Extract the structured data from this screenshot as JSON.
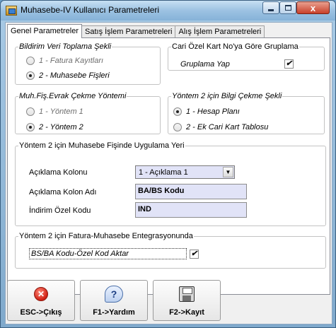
{
  "window": {
    "title": "Muhasebe-IV Kullanıcı Parametreleri"
  },
  "title_controls": {
    "minimize_icon": "minimize-icon",
    "maximize_icon": "maximize-icon",
    "close_glyph": "x"
  },
  "tabs": [
    {
      "label": "Genel Parametreler",
      "active": true
    },
    {
      "label": "Satış İşlem Parametreleri",
      "active": false
    },
    {
      "label": "Alış İşlem Parametreleri",
      "active": false
    }
  ],
  "groups": {
    "bildirim": {
      "legend": "Bildirim Veri Toplama Şekli",
      "options": [
        {
          "label": "1 - Fatura Kayıtları",
          "selected": false
        },
        {
          "label": "2 - Muhasebe Fişleri",
          "selected": true
        }
      ]
    },
    "cari": {
      "legend": "Cari Özel Kart No'ya Göre Gruplama",
      "checkbox_label": "Gruplama Yap",
      "checked": true
    },
    "muhfis": {
      "legend": "Muh.Fiş.Evrak Çekme Yöntemi",
      "options": [
        {
          "label": "1 - Yöntem 1",
          "selected": false
        },
        {
          "label": "2 - Yöntem 2",
          "selected": true
        }
      ]
    },
    "yontem2bilgi": {
      "legend": "Yöntem 2 için Bilgi Çekme Şekli",
      "options": [
        {
          "label": "1 - Hesap Planı",
          "selected": true
        },
        {
          "label": "2 - Ek Cari Kart Tablosu",
          "selected": false
        }
      ]
    },
    "yontem2muh": {
      "legend": "Yöntem 2 için Muhasebe Fişinde Uygulama Yeri",
      "aciklama_kolonu_label": "Açıklama Kolonu",
      "aciklama_kolonu_value": "1 - Açıklama 1",
      "aciklama_kolon_adi_label": "Açıklama Kolon Adı",
      "aciklama_kolon_adi_value": "BA/BS Kodu",
      "indirim_ozel_kodu_label": "İndirim Özel Kodu",
      "indirim_ozel_kodu_value": "IND"
    },
    "yontem2fatura": {
      "legend": "Yöntem 2 için Fatura-Muhasebe Entegrasyonunda",
      "checkbox_label": "BS/BA Kodu-Özel Kod Aktar",
      "checked": true
    }
  },
  "toolbar": {
    "esc_label": "ESC->Çıkış",
    "help_label": "F1->Yardım",
    "save_label": "F2->Kayıt",
    "check_glyph": "✔"
  }
}
